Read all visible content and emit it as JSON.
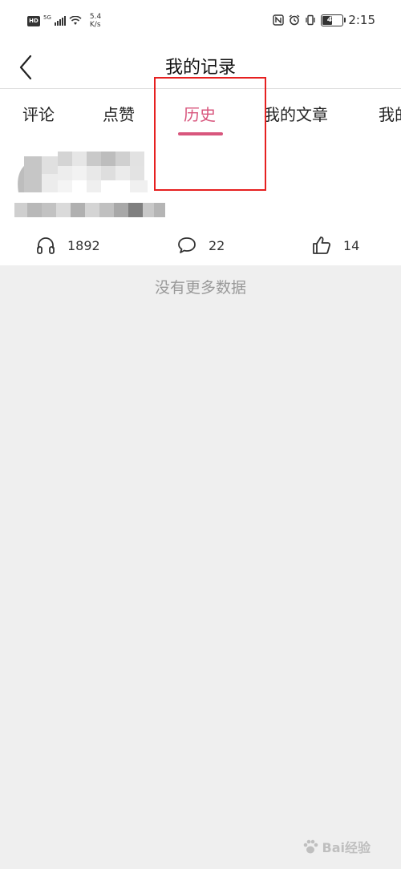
{
  "status_bar": {
    "hd": "HD",
    "network": "5G",
    "speed_value": "5.4",
    "speed_unit": "K/s",
    "battery": "47",
    "time": "2:15"
  },
  "header": {
    "title": "我的记录"
  },
  "tabs": [
    {
      "label": "评论",
      "active": false
    },
    {
      "label": "点赞",
      "active": false
    },
    {
      "label": "历史",
      "active": true
    },
    {
      "label": "我的文章",
      "active": false
    },
    {
      "label": "我的",
      "active": false
    }
  ],
  "card": {
    "listens": "1892",
    "comments": "22",
    "likes": "14"
  },
  "footer_message": "没有更多数据",
  "watermark": {
    "text": "Bai经验"
  },
  "colors": {
    "accent": "#d8567d",
    "highlight_box": "#e62020",
    "background": "#efefef"
  }
}
